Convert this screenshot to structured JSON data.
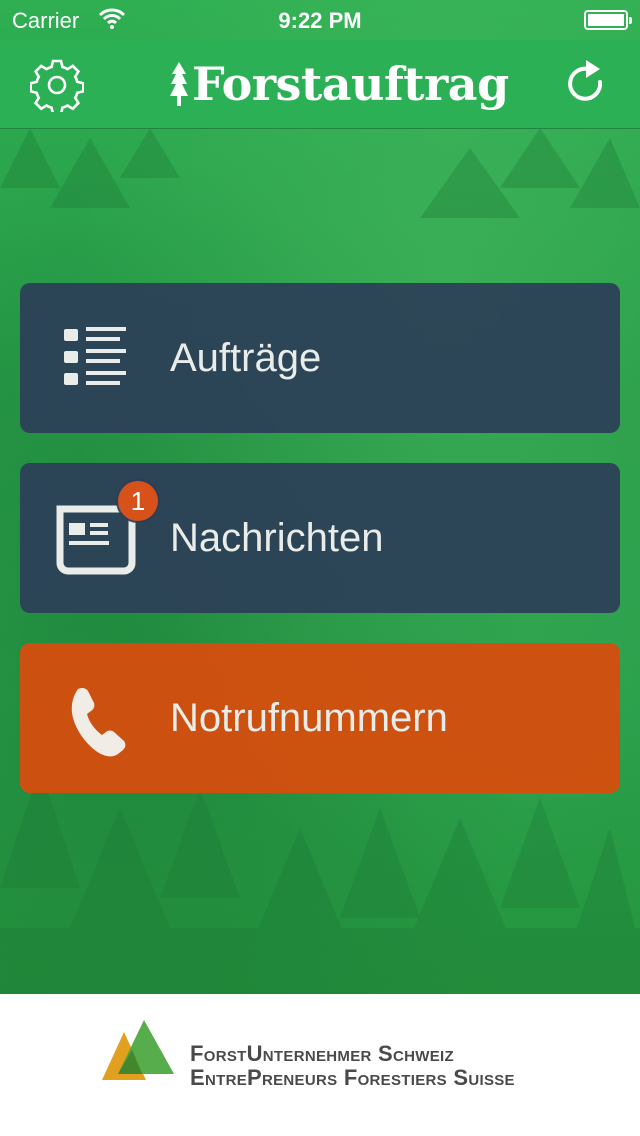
{
  "status_bar": {
    "carrier": "Carrier",
    "time": "9:22 PM"
  },
  "nav": {
    "title": "Forstauftrag",
    "settings_icon": "gear-icon",
    "refresh_icon": "refresh-icon"
  },
  "menu": {
    "items": [
      {
        "label": "Aufträge",
        "icon": "list-icon",
        "color": "#2d3e58"
      },
      {
        "label": "Nachrichten",
        "icon": "message-card-icon",
        "badge": "1",
        "color": "#2d3e58"
      },
      {
        "label": "Notrufnummern",
        "icon": "phone-icon",
        "color": "#d64e0e"
      }
    ]
  },
  "footer": {
    "org_line1": "ForstUnternehmer Schweiz",
    "org_line2": "EntrePreneurs Forestiers Suisse"
  }
}
